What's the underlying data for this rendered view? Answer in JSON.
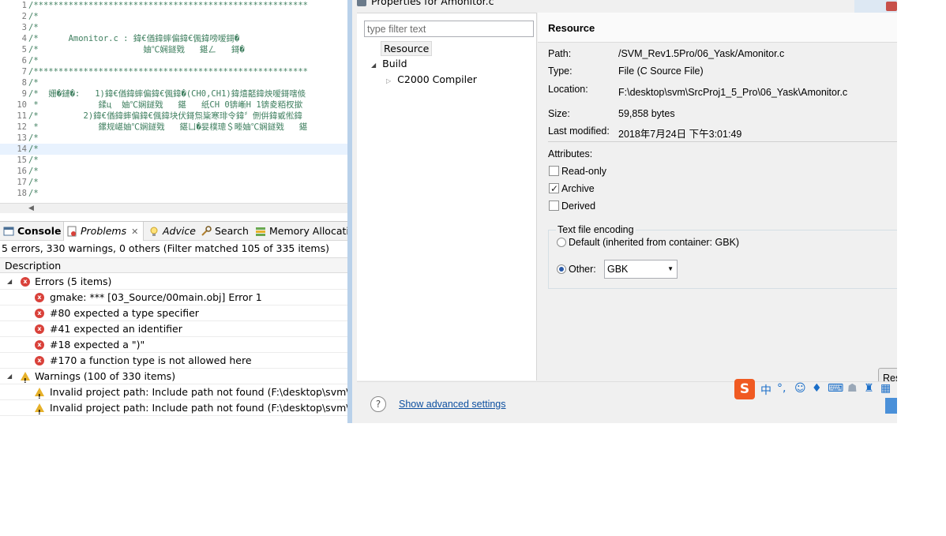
{
  "editor": {
    "lines": [
      {
        "n": "1",
        "text": "/*******************************************************"
      },
      {
        "n": "2",
        "text": "/*"
      },
      {
        "n": "3",
        "text": "/*"
      },
      {
        "n": "4",
        "text": "/*      Amonitor.c : 鍏€偤鍏蟀偏鍏€偑鍏嗙嗳鎶�"
      },
      {
        "n": "5",
        "text": "/*                     妯℃娴鐩戣   鍖ㄥ   鎶�"
      },
      {
        "n": "6",
        "text": "/*"
      },
      {
        "n": "7",
        "text": "/*******************************************************"
      },
      {
        "n": "8",
        "text": "/*"
      },
      {
        "n": "9",
        "text": "/*  姗�鏈�:   1)鍏€偤鍏蟀偏鍏€偑鍏�(CH0,CH1)鍏熺嚭鍏炴嗳鎶嗐倐"
      },
      {
        "n": "10",
        "text": " *            鍒ц  妯℃娴鐩戣   鍖   纸CH 0锛嶃H 1锛夌粨杈撳"
      },
      {
        "n": "11",
        "text": "/*         2)鍏€偤鍏蟀偏鍏€偑鍏块伏鎶炰粊寒琲令鍏〞侀倂鍏戜倯鍏"
      },
      {
        "n": "12",
        "text": " *            鏍规嵁妯℃娴鐩戣   鍖ㄩ�妟樸璁＄畻妯℃娴鐩戣   鍖"
      },
      {
        "n": "13",
        "text": "/*"
      },
      {
        "n": "14",
        "text": "/*"
      },
      {
        "n": "15",
        "text": "/*"
      },
      {
        "n": "16",
        "text": "/*"
      },
      {
        "n": "17",
        "text": "/*"
      },
      {
        "n": "18",
        "text": "/*"
      }
    ]
  },
  "views": {
    "tabs": {
      "console": "Console",
      "problems": "Problems",
      "advice": "Advice",
      "search": "Search",
      "memory": "Memory Allocatio"
    },
    "summary": "5 errors, 330 warnings, 0 others (Filter matched 105 of 335 items)",
    "column_header": "Description",
    "errors_group": "Errors (5 items)",
    "errors": [
      "gmake: *** [03_Source/00main.obj] Error 1",
      "#80 expected a type specifier",
      "#41 expected an identifier",
      "#18 expected a \")\"",
      "#170 a function type is not allowed here"
    ],
    "warnings_group": "Warnings (100 of 330 items)",
    "warnings": [
      "Invalid project path: Include path not found (F:\\desktop\\svm\\SrcP",
      "Invalid project path: Include path not found (F:\\desktop\\svm\\SrcP"
    ]
  },
  "dialog": {
    "title": "Properties for Amonitor.c",
    "filter_placeholder": "type filter text",
    "tree": {
      "resource": "Resource",
      "build": "Build",
      "c2000": "C2000 Compiler"
    },
    "heading": "Resource",
    "props": {
      "path_label": "Path:",
      "path_value": "/SVM_Rev1.5Pro/06_Yask/Amonitor.c",
      "type_label": "Type:",
      "type_value": "File  (C Source File)",
      "location_label": "Location:",
      "location_value": "F:\\desktop\\svm\\SrcProj1_5_Pro\\06_Yask\\Amonitor.c",
      "size_label": "Size:",
      "size_value": "59,858  bytes",
      "modified_label": "Last modified:",
      "modified_value": "2018年7月24日 下午3:01:49"
    },
    "attributes_label": "Attributes:",
    "readonly_label": "Read-only",
    "archive_label": "Archive",
    "derived_label": "Derived",
    "encoding": {
      "title": "Text file encoding",
      "default_label": "Default (inherited from container: GBK)",
      "other_label": "Other:",
      "other_value": "GBK"
    },
    "restore_label": "Restore Defaults",
    "advanced_link": "Show advanced settings"
  },
  "ime": {
    "logo": "S",
    "lang": "中"
  },
  "colors": {
    "error": "#d9413a",
    "warning": "#e6b12a",
    "link": "#0e50a0",
    "accent": "#2a5aa8"
  }
}
